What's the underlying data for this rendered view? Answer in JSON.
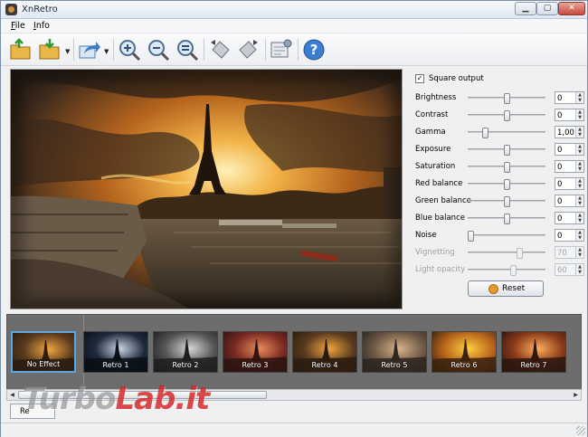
{
  "window": {
    "title": "XnRetro"
  },
  "menu": [
    {
      "label": "File"
    },
    {
      "label": "Info"
    }
  ],
  "toolbar": {
    "buttons": [
      {
        "name": "open-folder-icon"
      },
      {
        "name": "save-folder-icon"
      },
      {
        "name": "export-share-icon"
      },
      {
        "name": "zoom-in-icon"
      },
      {
        "name": "zoom-out-icon"
      },
      {
        "name": "zoom-fit-icon"
      },
      {
        "name": "rotate-left-icon"
      },
      {
        "name": "rotate-right-icon"
      },
      {
        "name": "settings-screen-icon"
      },
      {
        "name": "help-icon"
      }
    ]
  },
  "settings": {
    "square_output": {
      "label": "Square output",
      "checked": true
    },
    "sliders": [
      {
        "label": "Brightness",
        "value": "0",
        "pos": 0.5,
        "enabled": true
      },
      {
        "label": "Contrast",
        "value": "0",
        "pos": 0.5,
        "enabled": true
      },
      {
        "label": "Gamma",
        "value": "1,00",
        "pos": 0.22,
        "enabled": true
      },
      {
        "label": "Exposure",
        "value": "0",
        "pos": 0.5,
        "enabled": true
      },
      {
        "label": "Saturation",
        "value": "0",
        "pos": 0.5,
        "enabled": true
      },
      {
        "label": "Red balance",
        "value": "0",
        "pos": 0.5,
        "enabled": true
      },
      {
        "label": "Green balance",
        "value": "0",
        "pos": 0.5,
        "enabled": true
      },
      {
        "label": "Blue balance",
        "value": "0",
        "pos": 0.5,
        "enabled": true
      },
      {
        "label": "Noise",
        "value": "0",
        "pos": 0.04,
        "enabled": true
      },
      {
        "label": "Vignetting",
        "value": "70",
        "pos": 0.66,
        "enabled": false
      },
      {
        "label": "Light opacity",
        "value": "60",
        "pos": 0.58,
        "enabled": false
      }
    ],
    "reset_label": "Reset"
  },
  "effects": [
    {
      "label": "No Effect",
      "selected": true,
      "tone": "orig"
    },
    {
      "label": "Retro 1",
      "selected": false,
      "tone": "bw-blue"
    },
    {
      "label": "Retro 2",
      "selected": false,
      "tone": "grey"
    },
    {
      "label": "Retro 3",
      "selected": false,
      "tone": "red"
    },
    {
      "label": "Retro 4",
      "selected": false,
      "tone": "orig"
    },
    {
      "label": "Retro 5",
      "selected": false,
      "tone": "muted"
    },
    {
      "label": "Retro 6",
      "selected": false,
      "tone": "gold"
    },
    {
      "label": "Retro 7",
      "selected": false,
      "tone": "warm"
    }
  ],
  "bottom": {
    "tab_label": "Re"
  },
  "watermark": {
    "text_a": "Turbo",
    "text_b": "Lab.it"
  },
  "colors": {
    "accent": "#5aa7e6",
    "sky_orange": "#e8922a",
    "reset_orange": "#e59a2f"
  }
}
